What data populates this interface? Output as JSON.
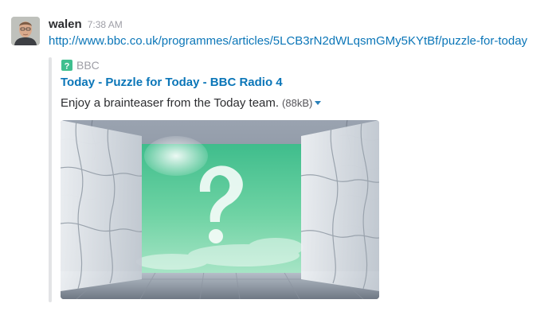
{
  "message": {
    "author": "walen",
    "timestamp": "7:38 AM",
    "link_text": "http://www.bbc.co.uk/programmes/articles/5LCB3rN2dWLqsmGMy5KYtBf/puzzle-for-today"
  },
  "attachment": {
    "service_name": "BBC",
    "service_icon": "bbc-favicon-icon",
    "title": "Today - Puzzle for Today - BBC Radio 4",
    "text": "Enjoy a brainteaser from the Today team.",
    "size": "(88kB)",
    "image": "puzzle-doorway-question-mark-image"
  },
  "colors": {
    "link": "#0b76b8",
    "muted": "#9e9ea6",
    "text": "#2c2d30",
    "attachment_bar": "#e3e4e6",
    "image_sky": "#5fc99a"
  }
}
